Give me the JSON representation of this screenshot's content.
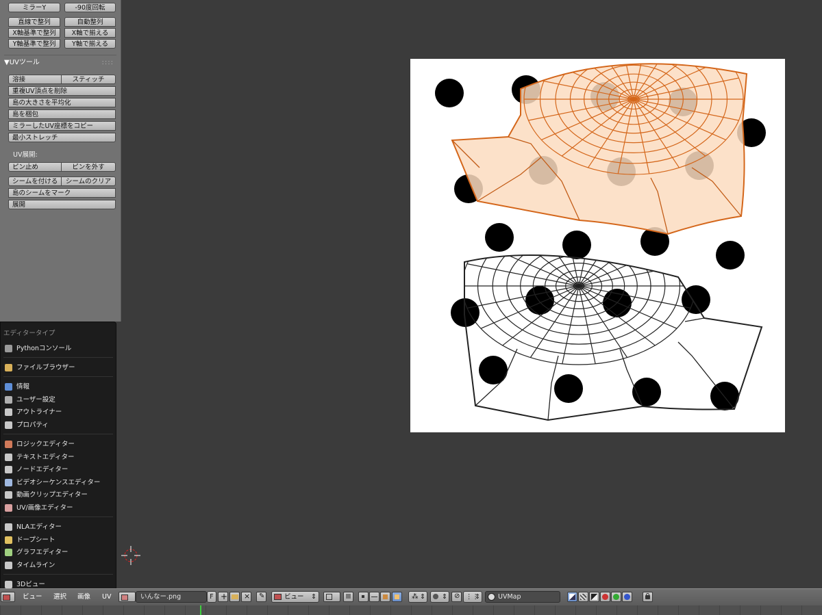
{
  "tool_panel": {
    "buttons_top": {
      "mirror_y": "ミラーY",
      "rotate_90": "-90度回転",
      "align_straight": "直線で整列",
      "align_auto": "自動整列",
      "align_x_based": "X軸基準で整列",
      "align_x": "X軸で揃える",
      "align_y_based": "Y軸基準で整列",
      "align_y": "Y軸で揃える"
    },
    "uv_tools": {
      "title": "▼UVツール",
      "weld": "溶接",
      "stitch": "スティッチ",
      "remove_doubles": "重複UV頂点を削除",
      "average_islands": "島の大きさを平均化",
      "pack_islands": "島を梱包",
      "copy_mirrored": "ミラーしたUV座標をコピー",
      "minimize_stretch": "最小ストレッチ"
    },
    "uv_unwrap": {
      "label": "UV展開:",
      "pin": "ピン止め",
      "unpin": "ピンを外す",
      "mark_seam": "シームを付ける",
      "clear_seam": "シームのクリア",
      "seams_from_islands": "島のシームをマーク",
      "unwrap": "展開"
    }
  },
  "editor_menu": {
    "title": "エディタータイプ",
    "items": [
      {
        "label": "Pythonコンソール",
        "icon": "console-icon",
        "color": "#9a9a9a"
      },
      {
        "label": "ファイルブラウザー",
        "icon": "folder-icon",
        "color": "#d9b15a"
      },
      {
        "label": "情報",
        "icon": "info-icon",
        "color": "#5f8fd8"
      },
      {
        "label": "ユーザー設定",
        "icon": "preferences-icon",
        "color": "#b0b0b0"
      },
      {
        "label": "アウトライナー",
        "icon": "outliner-icon",
        "color": "#c8c8c8"
      },
      {
        "label": "プロパティ",
        "icon": "properties-icon",
        "color": "#c8c8c8"
      },
      {
        "label": "ロジックエディター",
        "icon": "logic-icon",
        "color": "#d07a5a"
      },
      {
        "label": "テキストエディター",
        "icon": "text-icon",
        "color": "#c8c8c8"
      },
      {
        "label": "ノードエディター",
        "icon": "node-icon",
        "color": "#c8c8c8"
      },
      {
        "label": "ビデオシーケンスエディター",
        "icon": "sequencer-icon",
        "color": "#9fb8e0"
      },
      {
        "label": "動画クリップエディター",
        "icon": "clip-icon",
        "color": "#c8c8c8"
      },
      {
        "label": "UV/画像エディター",
        "icon": "image-icon",
        "color": "#d9a0a0"
      },
      {
        "label": "NLAエディター",
        "icon": "nla-icon",
        "color": "#c8c8c8"
      },
      {
        "label": "ドープシート",
        "icon": "dopesheet-icon",
        "color": "#e0c060"
      },
      {
        "label": "グラフエディター",
        "icon": "graph-icon",
        "color": "#a0d080"
      },
      {
        "label": "タイムライン",
        "icon": "timeline-icon",
        "color": "#c8c8c8"
      },
      {
        "label": "3Dビュー",
        "icon": "view3d-icon",
        "color": "#c8c8c8"
      }
    ]
  },
  "header": {
    "menus": [
      "ビュー",
      "選択",
      "画像",
      "UV"
    ],
    "image_name": "いんなー.png",
    "fake_user": "F",
    "view_mode": "ビュー",
    "uvmap": "UVMap"
  },
  "colors": {
    "selected_island_fill": "#fbdcbf",
    "selected_edge": "#d4661a",
    "unselected_edge": "#222222",
    "texture_bg": "#ffffff",
    "viewport_bg": "#3b3b3b",
    "timeline_playhead": "#3fcf3f"
  }
}
